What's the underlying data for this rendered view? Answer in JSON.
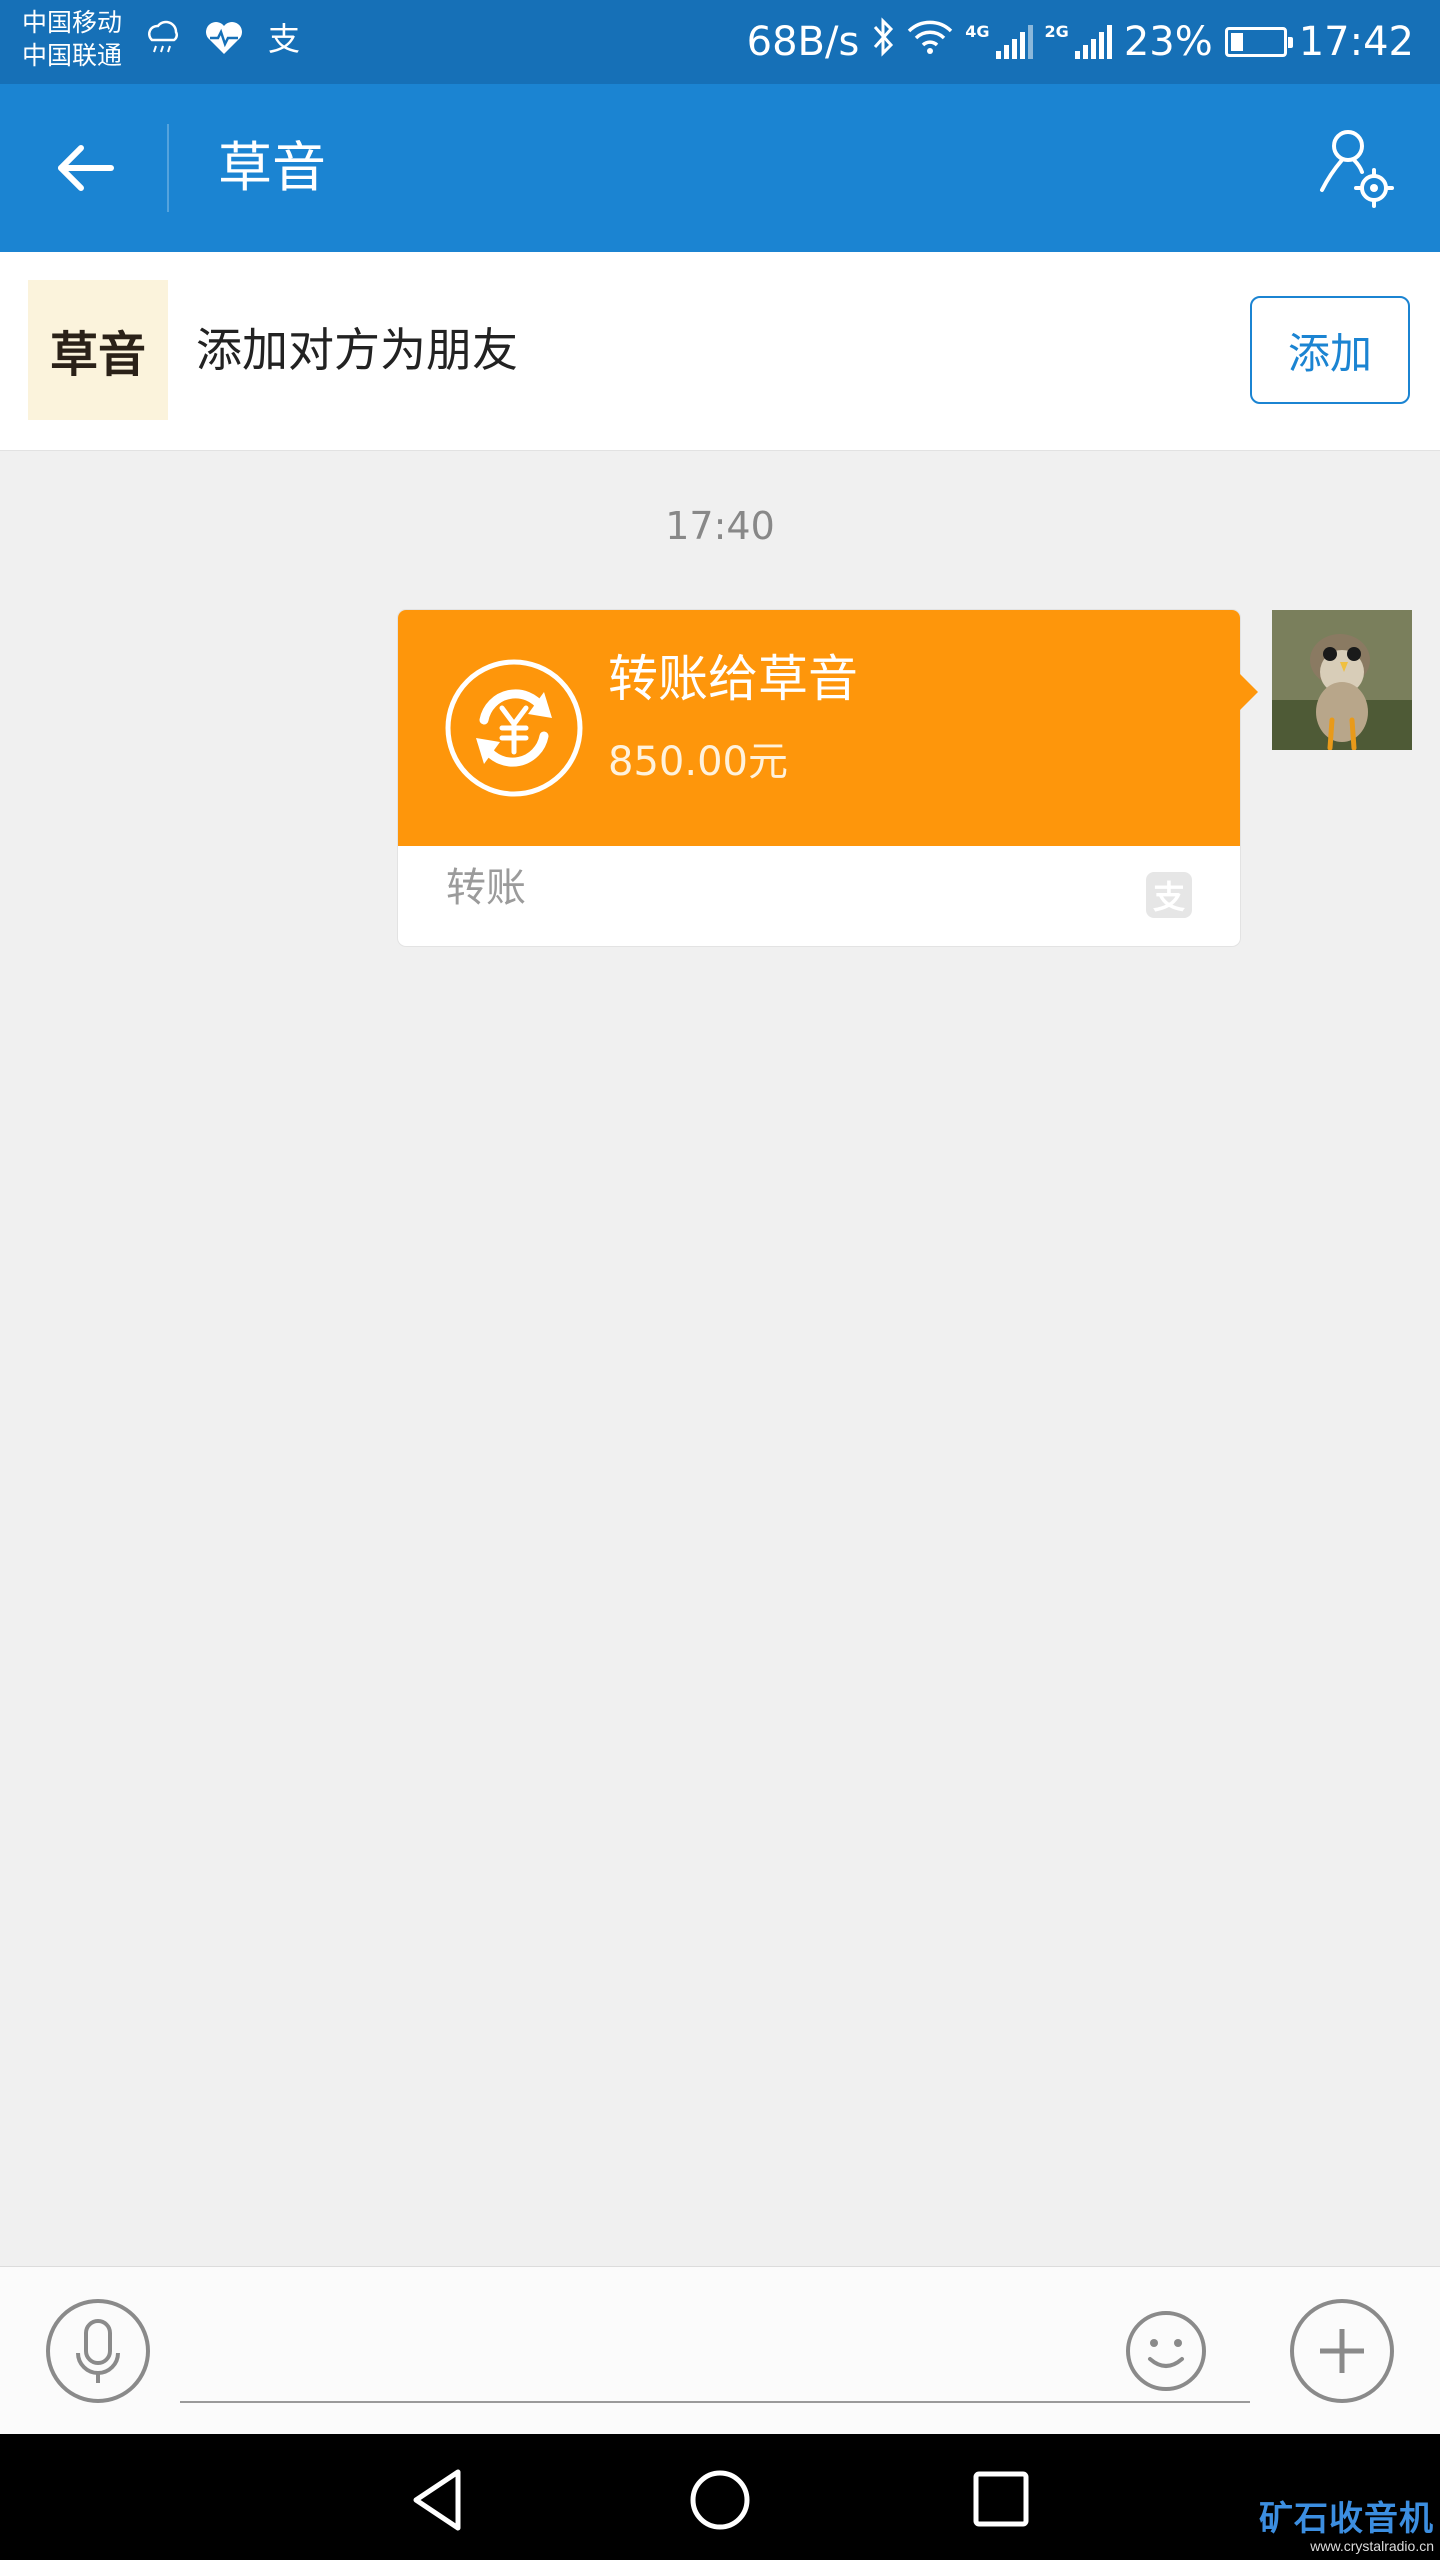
{
  "status_bar": {
    "carrier_1": "中国移动",
    "carrier_2": "中国联通",
    "left_icons": [
      "weather-icon",
      "health-heart-icon",
      "alipay-icon"
    ],
    "net_speed": "68B/s",
    "network_tag_1": "4G",
    "network_tag_2": "2G",
    "battery_percent_text": "23%",
    "battery_level": 0.23,
    "time": "17:42"
  },
  "header": {
    "title": "草音",
    "back_icon": "back-arrow-icon",
    "profile_icon": "user-settings-icon"
  },
  "add_friend": {
    "logo_text": "草音",
    "message": "添加对方为朋友",
    "button_label": "添加"
  },
  "chat": {
    "timestamp": "17:40",
    "transfer": {
      "title": "转账给草音",
      "amount": "850.00元",
      "label": "转账",
      "icon": "yuan-transfer-icon"
    }
  },
  "input_bar": {
    "placeholder": "",
    "voice_icon": "microphone-icon",
    "emoji_icon": "smiley-icon",
    "plus_icon": "plus-icon"
  },
  "watermark": {
    "text": "矿石收音机",
    "url": "www.crystalradio.cn"
  },
  "colors": {
    "header_blue": "#1b84d2",
    "status_blue": "#1670b7",
    "transfer_orange": "#fe960b",
    "background": "#f0f0f0"
  }
}
